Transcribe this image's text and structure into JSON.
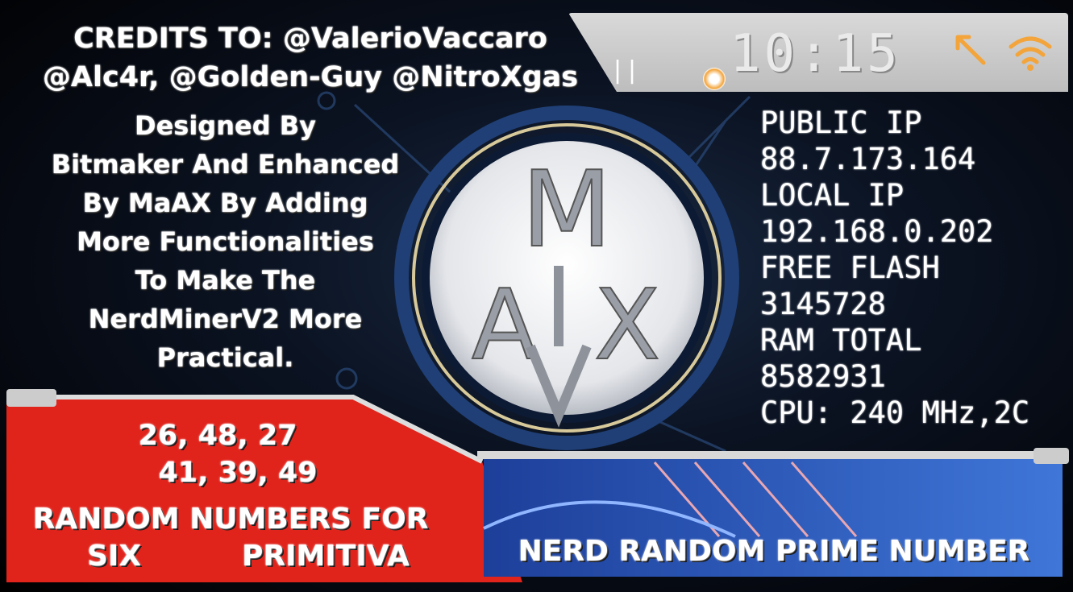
{
  "credits": {
    "line1": "CREDITS TO: @ValerioVaccaro",
    "line2": "@Alc4r, @Golden-Guy @NitroXgas"
  },
  "designed_by": {
    "lines": [
      "Designed By",
      "Bitmaker And Enhanced",
      "By MaAX By Adding",
      "More Functionalities",
      "To Make The",
      "NerdMinerV2 More",
      "Practical."
    ]
  },
  "status_bar": {
    "pause_glyph": "||",
    "time": "10:15",
    "icons": [
      "key-icon",
      "wifi-icon"
    ],
    "accent_color": "#f3a43a"
  },
  "logo": {
    "letters": [
      "M",
      "A",
      "X"
    ]
  },
  "system_info": {
    "public_ip_label": "PUBLIC IP",
    "public_ip": "88.7.173.164",
    "local_ip_label": "LOCAL IP",
    "local_ip": "192.168.0.202",
    "free_flash_label": "FREE FLASH",
    "free_flash": "3145728",
    "ram_total_label": "RAM TOTAL",
    "ram_total": "8582931",
    "cpu": "CPU: 240 MHz,2C"
  },
  "lotto": {
    "numbers_line1": "26, 48, 27",
    "numbers_line2": "41, 39, 49",
    "label_line1": "RANDOM NUMBERS FOR",
    "label_line2_left": "SIX",
    "label_line2_right": "PRIMITIVA",
    "panel_color": "#e0241c"
  },
  "prime": {
    "label": "NERD RANDOM PRIME NUMBER",
    "value": "",
    "panel_color": "#2457c4"
  }
}
